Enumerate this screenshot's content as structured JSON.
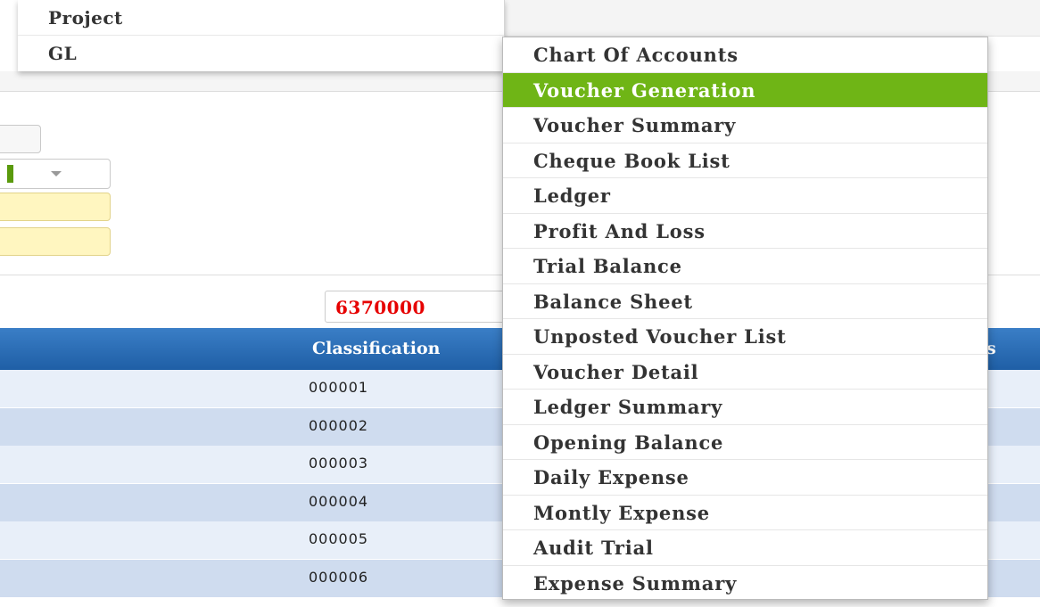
{
  "parent_menu": {
    "items": [
      {
        "label": "Project"
      },
      {
        "label": "GL"
      }
    ]
  },
  "gl_submenu": {
    "active_label": "Voucher Generation",
    "items": [
      {
        "label": "Chart Of Accounts"
      },
      {
        "label": "Voucher Generation"
      },
      {
        "label": "Voucher Summary"
      },
      {
        "label": "Cheque Book List"
      },
      {
        "label": "Ledger"
      },
      {
        "label": "Profit And Loss"
      },
      {
        "label": "Trial Balance"
      },
      {
        "label": "Balance Sheet"
      },
      {
        "label": "Unposted Voucher List"
      },
      {
        "label": "Voucher Detail"
      },
      {
        "label": "Ledger Summary"
      },
      {
        "label": "Opening Balance"
      },
      {
        "label": "Daily Expense"
      },
      {
        "label": "Montly Expense"
      },
      {
        "label": "Audit Trial"
      },
      {
        "label": "Expense Summary"
      }
    ]
  },
  "summary": {
    "total_value": "6370000",
    "total_color": "#e60000"
  },
  "grid": {
    "columns": {
      "classification": "Classification",
      "tail_fragment": "s"
    },
    "rows": [
      {
        "code": "000001"
      },
      {
        "code": "000002"
      },
      {
        "code": "000003"
      },
      {
        "code": "000004"
      },
      {
        "code": "000005"
      },
      {
        "code": "000006"
      }
    ]
  },
  "colors": {
    "active_menu_bg": "#6fb516",
    "grid_header_bg": "#2a6db5",
    "row_odd": "#e8eff9",
    "row_even": "#cfdcef",
    "input_highlight": "#fff6c0"
  }
}
